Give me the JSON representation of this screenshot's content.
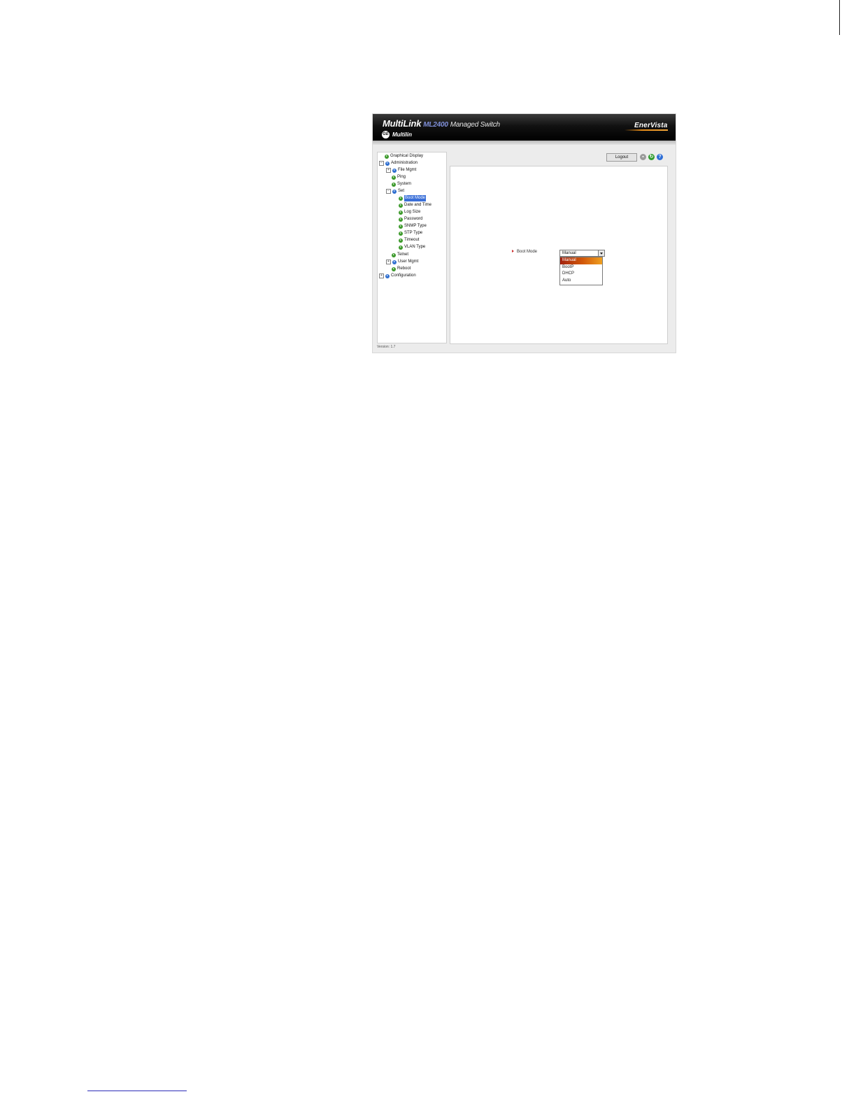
{
  "header": {
    "brand": "MultiLink",
    "model": "ML2400",
    "subtitle": "Managed Switch",
    "sub_brand": "Multilin",
    "logo_text": "GE",
    "right_brand": "EnerVista"
  },
  "toolbar": {
    "logout_label": "Logout",
    "icons": [
      "save-icon",
      "refresh-icon",
      "help-icon"
    ]
  },
  "tree": {
    "graphical_display": "Graphical Display",
    "administration": "Administration",
    "file_mgmt": "File Mgmt",
    "ping": "Ping",
    "system": "System",
    "set": "Set",
    "boot_mode": "Boot Mode",
    "date_time": "Date and Time",
    "log_size": "Log Size",
    "password": "Password",
    "snmp_type": "SNMP Type",
    "stp_type": "STP Type",
    "timeout": "Timeout",
    "vlan_type": "VLAN Type",
    "telnet": "Telnet",
    "user_mgmt": "User Mgmt",
    "reboot": "Reboot",
    "configuration": "Configuration",
    "selected": "Boot Mode"
  },
  "form": {
    "boot_mode_label": "Boot Mode",
    "boot_mode_value": "Manual",
    "options": [
      "Manual",
      "BootP",
      "DHCP",
      "Auto"
    ],
    "highlighted_option": "Manual"
  },
  "footer": {
    "version": "Version: 1.7"
  },
  "colors": {
    "selection_blue": "#3a6fd8",
    "dropdown_highlight": "#d35a0a",
    "node_green": "#3d9a2c",
    "node_blue": "#2f6fd0"
  }
}
